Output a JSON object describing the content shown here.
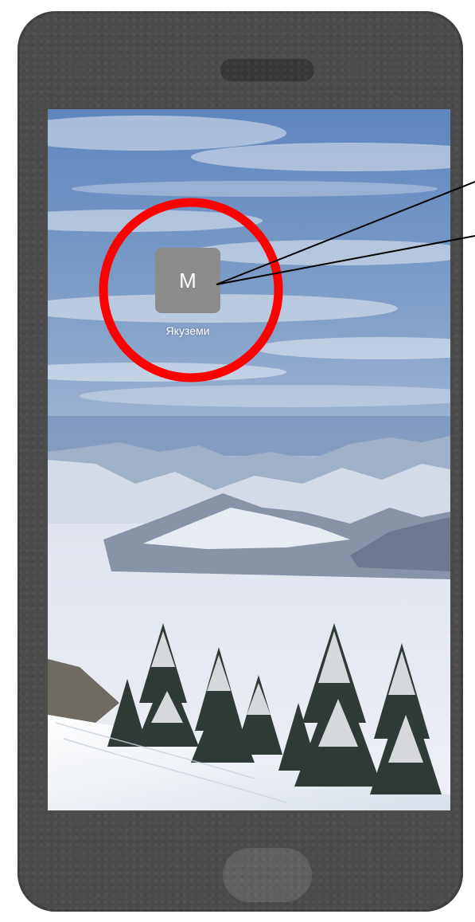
{
  "app": {
    "icon_letter": "M",
    "label": "Якуземи"
  },
  "colors": {
    "phone_body": "#4b4b4b",
    "icon_background": "#8c8c8c",
    "highlight_circle": "#ff0000",
    "pointer_lines": "#000000"
  }
}
